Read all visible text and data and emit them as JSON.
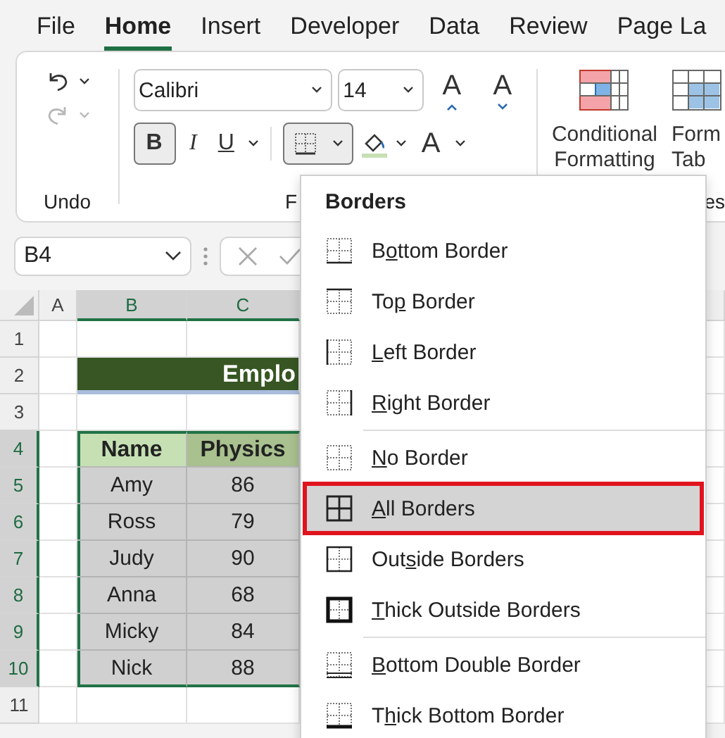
{
  "ribbon_tabs": [
    {
      "label": "File",
      "selected": false
    },
    {
      "label": "Home",
      "selected": true
    },
    {
      "label": "Insert",
      "selected": false
    },
    {
      "label": "Developer",
      "selected": false
    },
    {
      "label": "Data",
      "selected": false
    },
    {
      "label": "Review",
      "selected": false
    },
    {
      "label": "Page La",
      "selected": false
    }
  ],
  "ribbon": {
    "undo_group": {
      "label": "Undo",
      "redo_disabled": true
    },
    "font_group": {
      "label": "F",
      "font": "Calibri",
      "size": "14",
      "grow": "A",
      "shrink": "A",
      "bold": {
        "label": "B",
        "selected": true
      },
      "italic": "I",
      "underline": "U",
      "font_color": "A",
      "borders_active": true
    },
    "styles_group": {
      "label": "es",
      "conditional_formatting": [
        "Conditional",
        "Formatting"
      ],
      "format_table": [
        "Form",
        "Tab"
      ]
    }
  },
  "formula_bar": {
    "name_box": "B4"
  },
  "sheet": {
    "columns": [
      {
        "label": "A",
        "selected": false
      },
      {
        "label": "B",
        "selected": true
      },
      {
        "label": "C",
        "selected": true
      }
    ],
    "row_headers": [
      {
        "label": "1",
        "selected": false
      },
      {
        "label": "2",
        "selected": false
      },
      {
        "label": "3",
        "selected": false
      },
      {
        "label": "4",
        "selected": true
      },
      {
        "label": "5",
        "selected": true
      },
      {
        "label": "6",
        "selected": true
      },
      {
        "label": "7",
        "selected": true
      },
      {
        "label": "8",
        "selected": true
      },
      {
        "label": "9",
        "selected": true
      },
      {
        "label": "10",
        "selected": true
      },
      {
        "label": "11",
        "selected": false
      }
    ],
    "title": "Emplo",
    "table": {
      "columns": [
        "Name",
        "Physics"
      ],
      "rows": [
        [
          "Amy",
          "86"
        ],
        [
          "Ross",
          "79"
        ],
        [
          "Judy",
          "90"
        ],
        [
          "Anna",
          "68"
        ],
        [
          "Micky",
          "84"
        ],
        [
          "Nick",
          "88"
        ]
      ]
    }
  },
  "borders_menu": {
    "title": "Borders",
    "groups": [
      [
        {
          "kind": "bottom",
          "before": "B",
          "key": "o",
          "after": "ttom Border",
          "selected": false
        },
        {
          "kind": "top",
          "before": "To",
          "key": "p",
          "after": " Border",
          "selected": false
        },
        {
          "kind": "left",
          "key": "L",
          "after": "eft Border",
          "selected": false
        },
        {
          "kind": "right",
          "key": "R",
          "after": "ight Border",
          "selected": false
        }
      ],
      [
        {
          "kind": "none",
          "key": "N",
          "after": "o Border",
          "selected": false
        },
        {
          "kind": "all",
          "key": "A",
          "after": "ll Borders",
          "selected": true
        },
        {
          "kind": "outside",
          "before": "Out",
          "key": "s",
          "after": "ide Borders",
          "selected": false
        },
        {
          "kind": "thick_outside",
          "key": "T",
          "after": "hick Outside Borders",
          "selected": false
        }
      ],
      [
        {
          "kind": "bottom_double",
          "key": "B",
          "after": "ottom Double Border",
          "selected": false
        },
        {
          "kind": "thick_bottom",
          "before": "T",
          "key": "h",
          "after": "ick Bottom Border",
          "selected": false
        }
      ]
    ]
  }
}
